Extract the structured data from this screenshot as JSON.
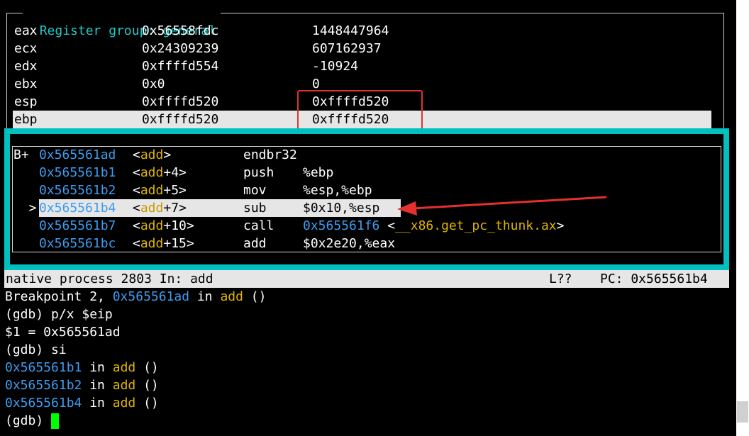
{
  "registers": {
    "title": "Register group: general",
    "rows": [
      {
        "name": "eax",
        "hex": "0x56558fdc",
        "natural": "1448447964"
      },
      {
        "name": "ecx",
        "hex": "0x24309239",
        "natural": "607162937"
      },
      {
        "name": "edx",
        "hex": "0xffffd554",
        "natural": "-10924"
      },
      {
        "name": "ebx",
        "hex": "0x0",
        "natural": "0"
      },
      {
        "name": "esp",
        "hex": "0xffffd520",
        "natural": "0xffffd520"
      },
      {
        "name": "ebp",
        "hex": "0xffffd520",
        "natural": "0xffffd520"
      }
    ],
    "highlighted_row": "ebp"
  },
  "disassembly": {
    "rows": [
      {
        "marker": "B+ ",
        "addr": "0x565561ad",
        "sym": "add",
        "offset": "",
        "mnemonic": "endbr32",
        "operands": "",
        "target_addr": "",
        "target_sym": ""
      },
      {
        "marker": "   ",
        "addr": "0x565561b1",
        "sym": "add",
        "offset": "+4",
        "mnemonic": "push",
        "operands": "%ebp",
        "target_addr": "",
        "target_sym": ""
      },
      {
        "marker": "   ",
        "addr": "0x565561b2",
        "sym": "add",
        "offset": "+5",
        "mnemonic": "mov",
        "operands": "%esp,%ebp",
        "target_addr": "",
        "target_sym": ""
      },
      {
        "marker": "  >",
        "addr": "0x565561b4",
        "sym": "add",
        "offset": "+7",
        "mnemonic": "sub",
        "operands": "$0x10,%esp",
        "target_addr": "",
        "target_sym": ""
      },
      {
        "marker": "   ",
        "addr": "0x565561b7",
        "sym": "add",
        "offset": "+10",
        "mnemonic": "call",
        "operands": "",
        "target_addr": "0x565561f6",
        "target_sym": "__x86.get_pc_thunk.ax"
      },
      {
        "marker": "   ",
        "addr": "0x565561bc",
        "sym": "add",
        "offset": "+15",
        "mnemonic": "add",
        "operands": "$0x2e20,%eax",
        "target_addr": "",
        "target_sym": ""
      }
    ]
  },
  "status": {
    "process": "native process 2803 In: add",
    "line": "L??",
    "pc": "PC: 0x565561b4"
  },
  "console": {
    "bp_prefix": "Breakpoint 2, ",
    "bp_addr": "0x565561ad",
    "bp_in": " in ",
    "bp_sym": "add",
    "bp_suffix": " ()",
    "cmd1": "(gdb) p/x $eip",
    "result1": "$1 = 0x565561ad",
    "cmd2": "(gdb) si",
    "steps": [
      {
        "addr": "0x565561b1",
        "in": " in ",
        "sym": "add",
        "suffix": " ()"
      },
      {
        "addr": "0x565561b2",
        "in": " in ",
        "sym": "add",
        "suffix": " ()"
      },
      {
        "addr": "0x565561b4",
        "in": " in ",
        "sym": "add",
        "suffix": " ()"
      }
    ],
    "prompt": "(gdb) "
  },
  "colors": {
    "background": "#000000",
    "panel_border": "#00c0c0",
    "address": "#3d9cf0",
    "symbol": "#e0b400",
    "highlight": "#e6e6e6",
    "annotation": "#e53030",
    "cursor": "#00ff00"
  }
}
